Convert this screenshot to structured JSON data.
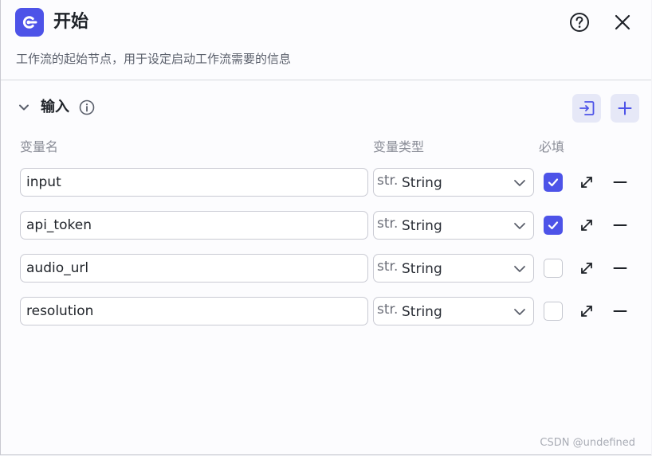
{
  "header": {
    "title": "开始",
    "description": "工作流的起始节点，用于设定启动工作流需要的信息",
    "icons": {
      "node": "start-node-icon",
      "help": "help-circle-icon",
      "close": "close-icon"
    }
  },
  "section": {
    "title": "输入",
    "icons": {
      "collapse": "chevron-down-icon",
      "info": "info-icon",
      "import": "import-icon",
      "add": "plus-icon"
    }
  },
  "columns": {
    "name": "变量名",
    "type": "变量类型",
    "required": "必填"
  },
  "variables": [
    {
      "name": "input",
      "type_prefix": "str.",
      "type": "String",
      "required": true
    },
    {
      "name": "api_token",
      "type_prefix": "str.",
      "type": "String",
      "required": true
    },
    {
      "name": "audio_url",
      "type_prefix": "str.",
      "type": "String",
      "required": false
    },
    {
      "name": "resolution",
      "type_prefix": "str.",
      "type": "String",
      "required": false
    }
  ],
  "watermark": "CSDN @undefined",
  "colors": {
    "accent": "#4d53e8",
    "accent_soft": "#e6e8f7",
    "text_primary": "#1f2329",
    "text_secondary": "#5a5f6b",
    "text_muted": "#8b8e98",
    "border": "#c9cad3"
  }
}
